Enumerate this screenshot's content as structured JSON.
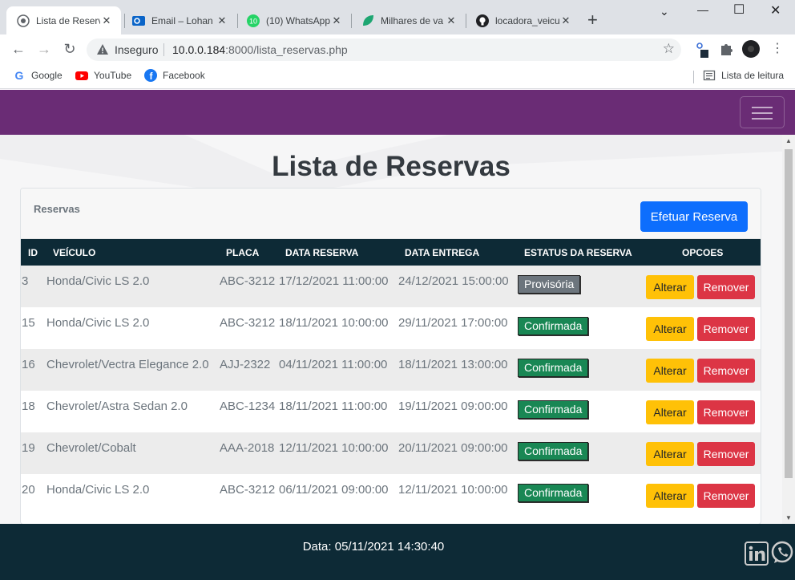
{
  "browser": {
    "tabs": [
      {
        "title": "Lista de Reservas",
        "active": true
      },
      {
        "title": "Email – Lohan"
      },
      {
        "title": "(10) WhatsApp"
      },
      {
        "title": "Milhares de va"
      },
      {
        "title": "locadora_veicu"
      }
    ],
    "whatsapp_badge": "10",
    "address": {
      "security_label": "Inseguro",
      "host": "10.0.0.184",
      "rest": ":8000/lista_reservas.php"
    },
    "bookmarks": [
      "Google",
      "YouTube",
      "Facebook"
    ],
    "reading_list": "Lista de leitura"
  },
  "page": {
    "title": "Lista de Reservas",
    "card_label": "Reservas",
    "new_reservation_button": "Efetuar Reserva",
    "columns": [
      "ID",
      "VEÍCULO",
      "PLACA",
      "DATA RESERVA",
      "DATA ENTREGA",
      "ESTATUS DA RESERVA",
      "OPCOES"
    ],
    "rows": [
      {
        "id": "3",
        "vehicle": "Honda/Civic LS 2.0",
        "plate": "ABC-3212",
        "reserved": "17/12/2021 11:00:00",
        "delivery": "24/12/2021 15:00:00",
        "status": "Provisória",
        "edit": "Alterar",
        "remove": "Remover"
      },
      {
        "id": "15",
        "vehicle": "Honda/Civic LS 2.0",
        "plate": "ABC-3212",
        "reserved": "18/11/2021 10:00:00",
        "delivery": "29/11/2021 17:00:00",
        "status": "Confirmada",
        "edit": "Alterar",
        "remove": "Remover"
      },
      {
        "id": "16",
        "vehicle": "Chevrolet/Vectra Elegance 2.0",
        "plate": "AJJ-2322",
        "reserved": "04/11/2021 11:00:00",
        "delivery": "18/11/2021 13:00:00",
        "status": "Confirmada",
        "edit": "Alterar",
        "remove": "Remover"
      },
      {
        "id": "18",
        "vehicle": "Chevrolet/Astra Sedan 2.0",
        "plate": "ABC-1234",
        "reserved": "18/11/2021 11:00:00",
        "delivery": "19/11/2021 09:00:00",
        "status": "Confirmada",
        "edit": "Alterar",
        "remove": "Remover"
      },
      {
        "id": "19",
        "vehicle": "Chevrolet/Cobalt",
        "plate": "AAA-2018",
        "reserved": "12/11/2021 10:00:00",
        "delivery": "20/11/2021 09:00:00",
        "status": "Confirmada",
        "edit": "Alterar",
        "remove": "Remover"
      },
      {
        "id": "20",
        "vehicle": "Honda/Civic LS 2.0",
        "plate": "ABC-3212",
        "reserved": "06/11/2021 09:00:00",
        "delivery": "12/11/2021 10:00:00",
        "status": "Confirmada",
        "edit": "Alterar",
        "remove": "Remover"
      }
    ],
    "footer_date": "Data: 05/11/2021 14:30:40"
  },
  "colors": {
    "navbar": "#6a2c75",
    "footer": "#0d2a36",
    "primary": "#0d6efd",
    "warning": "#ffc107",
    "danger": "#dc3545",
    "success": "#198754"
  }
}
